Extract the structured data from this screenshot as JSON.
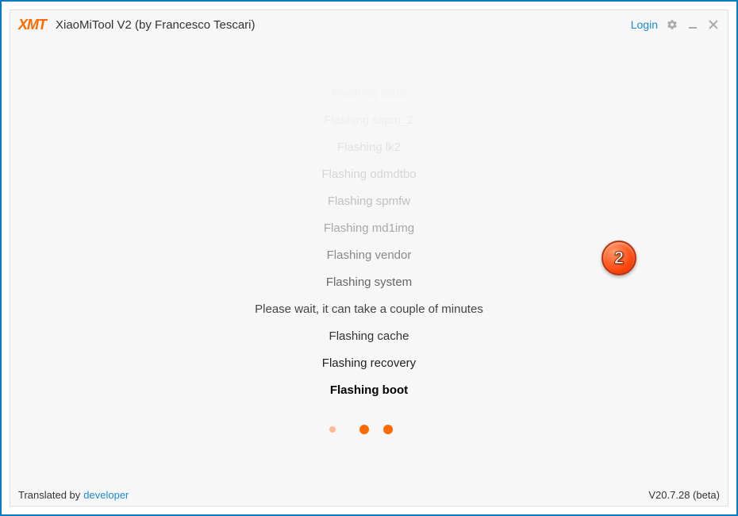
{
  "header": {
    "logo": "XMT",
    "title": "XiaoMiTool V2 (by Francesco Tescari)",
    "login": "Login"
  },
  "log": {
    "lines": [
      "Flashing scp2",
      "Flashing sspm_2",
      "Flashing lk2",
      "Flashing odmdtbo",
      "Flashing spmfw",
      "Flashing md1img",
      "Flashing vendor",
      "Flashing system",
      "Please wait, it can take a couple of minutes",
      "Flashing cache",
      "Flashing recovery",
      "Flashing boot"
    ]
  },
  "footer": {
    "translated_prefix": "Translated by",
    "translated_link": "developer",
    "version": "V20.7.28 (beta)"
  },
  "badge": {
    "number": "2"
  }
}
